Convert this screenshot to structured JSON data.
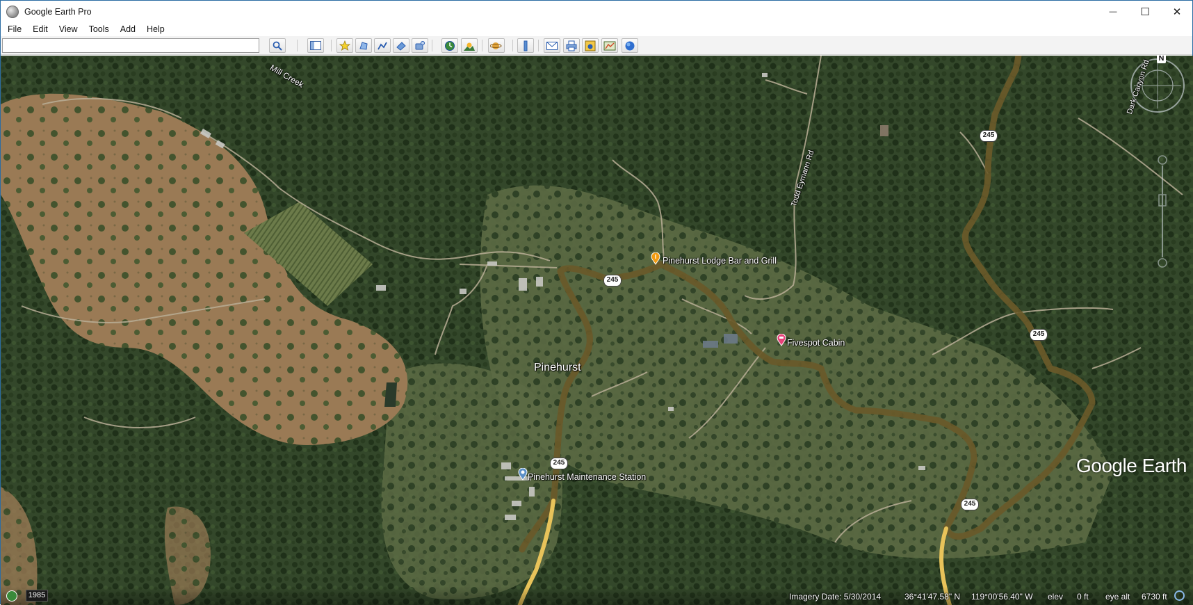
{
  "window": {
    "title": "Google Earth Pro",
    "controls": {
      "minimize": "—",
      "maximize": "☐",
      "close": "✕"
    }
  },
  "menu": {
    "items": [
      "File",
      "Edit",
      "View",
      "Tools",
      "Add",
      "Help"
    ]
  },
  "search": {
    "value": "",
    "placeholder": ""
  },
  "toolbar": {
    "buttons": [
      "search-icon",
      "sidebar-toggle-icon",
      "add-placemark-icon",
      "add-polygon-icon",
      "add-path-icon",
      "add-image-overlay-icon",
      "record-tour-icon",
      "historical-imagery-icon",
      "sunlight-icon",
      "switch-planet-icon",
      "ruler-icon",
      "email-icon",
      "print-icon",
      "save-image-icon",
      "view-in-maps-icon",
      "earth-globe-icon"
    ]
  },
  "map": {
    "places": [
      {
        "id": "lodge",
        "label": "Pinehurst Lodge Bar and Grill",
        "icon": "restaurant-pin-icon",
        "color": "#f39c12"
      },
      {
        "id": "cabin",
        "label": "Fivespot Cabin",
        "icon": "lodging-pin-icon",
        "color": "#e8417a"
      },
      {
        "id": "station",
        "label": "Pinehurst Maintenance Station",
        "icon": "building-pin-icon",
        "color": "#5b8fc7"
      }
    ],
    "town": "Pinehurst",
    "creek": "Mill Creek",
    "roads": {
      "todd": "Todd Eymann Rd",
      "dark_canyon": "Dark Canyon Rd"
    },
    "highway_shields": [
      "245",
      "245",
      "245",
      "245",
      "245"
    ],
    "compass_north": "N"
  },
  "status": {
    "year": "1985",
    "imagery_date": "Imagery Date: 5/30/2014",
    "lat": "36°41'47.58\" N",
    "lon": "119°00'56.40\" W",
    "elev_label": "elev",
    "elev_value": "0 ft",
    "eye_alt_label": "eye alt",
    "eye_alt_value": "6730 ft"
  },
  "brand": "Google Earth",
  "colors": {
    "highway": "#e8c35a",
    "terrain_dark": "#2f4124",
    "terrain_dry": "#9a7a52"
  }
}
